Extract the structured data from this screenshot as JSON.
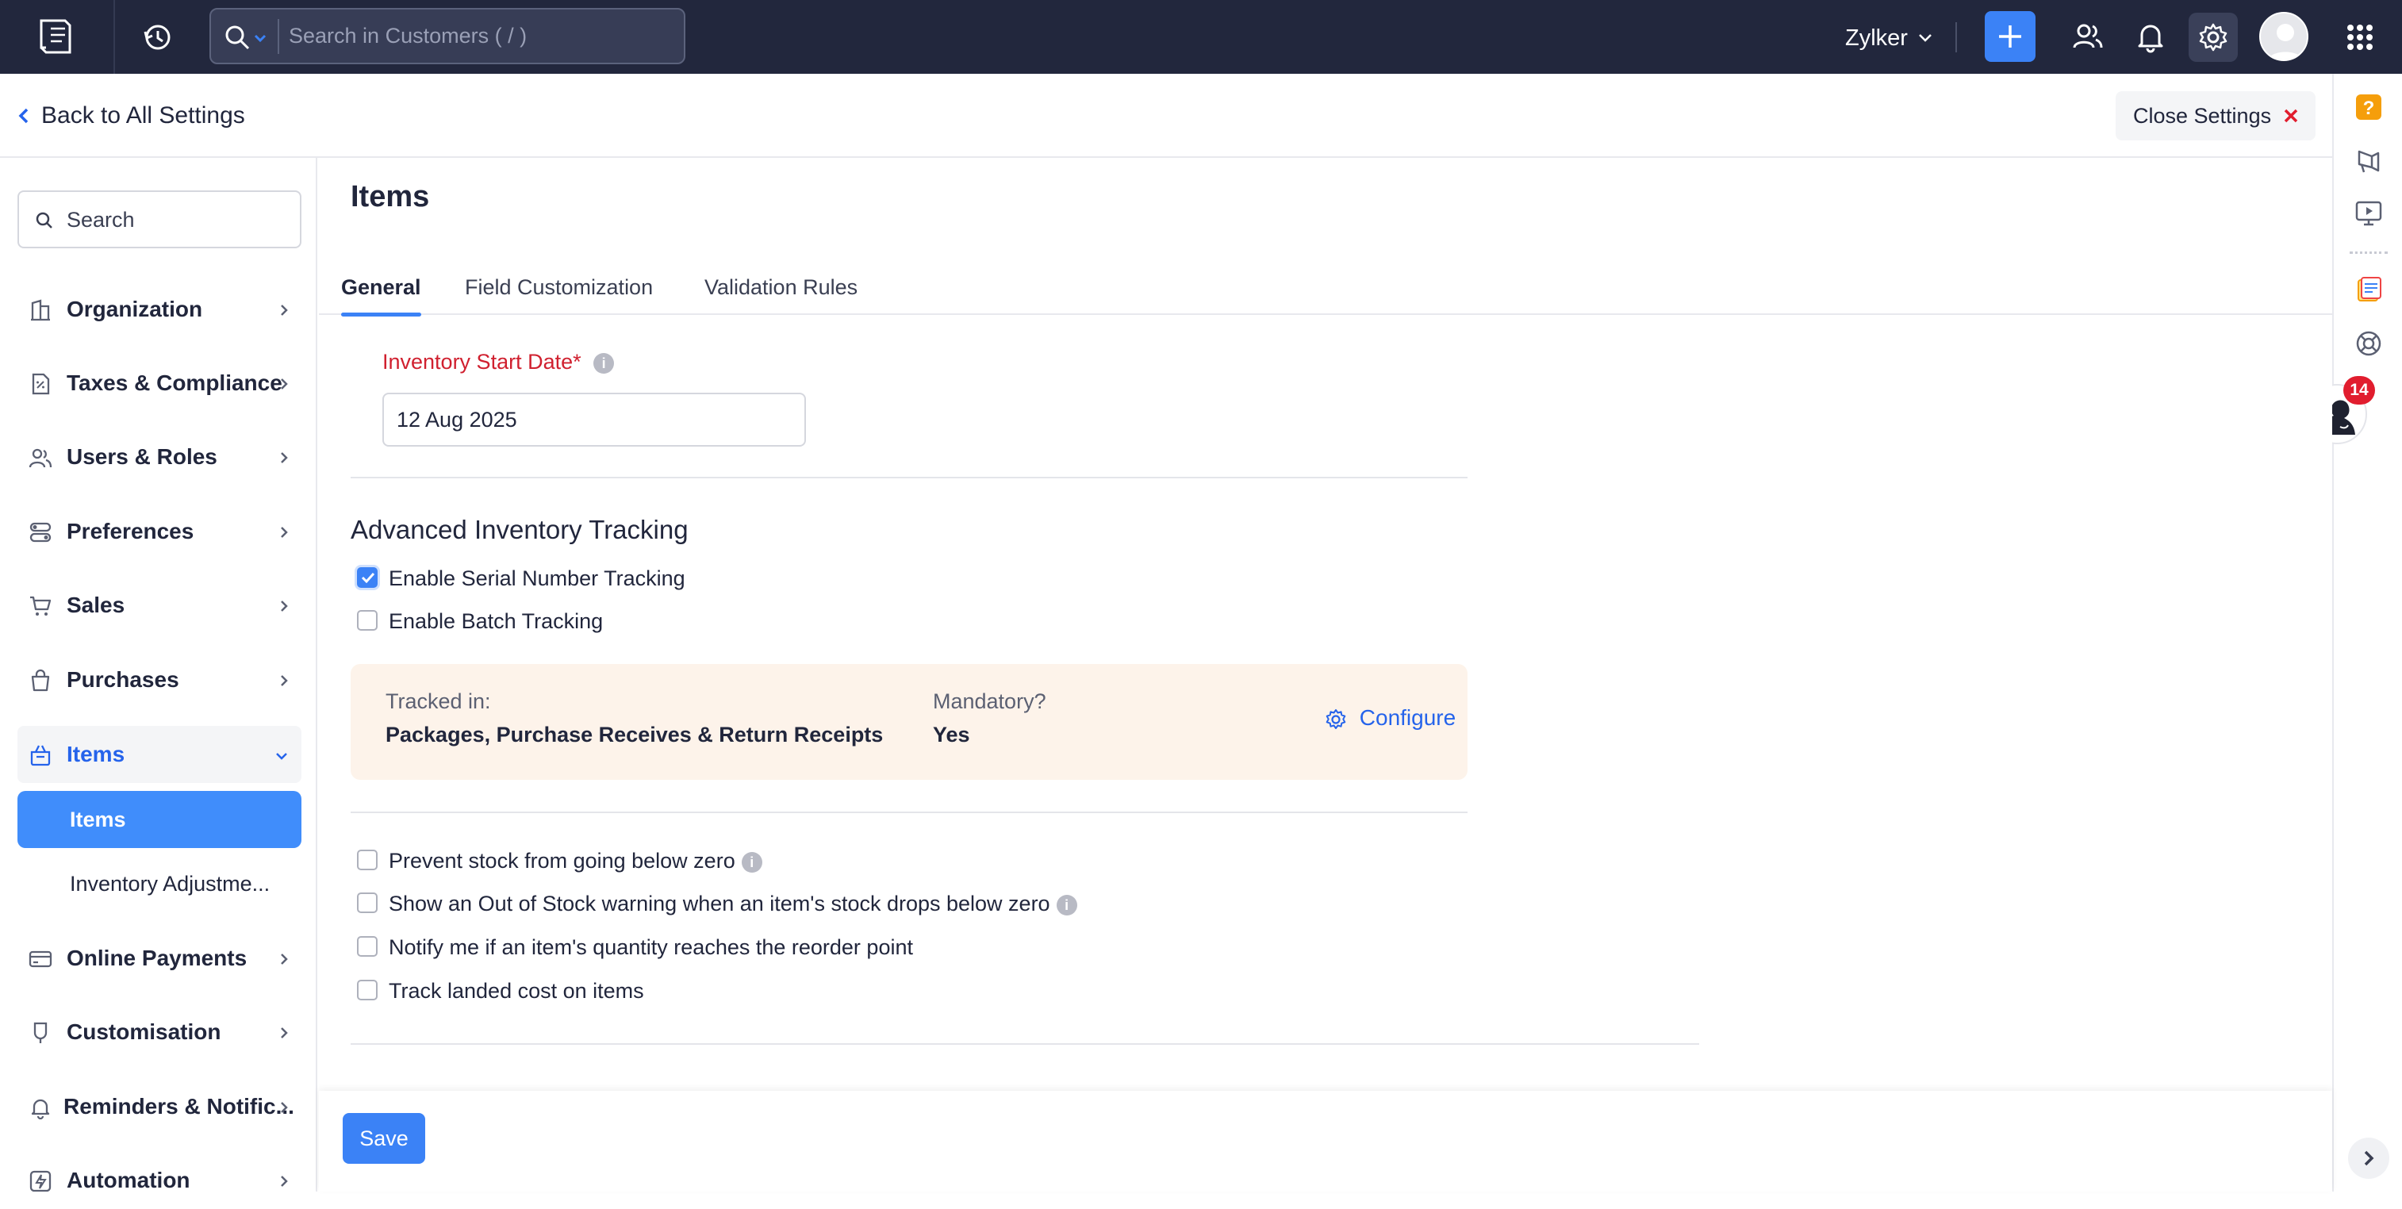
{
  "topbar": {
    "search_placeholder": "Search in Customers ( / )",
    "org_name": "Zylker"
  },
  "header": {
    "back_label": "Back to All Settings",
    "close_label": "Close Settings"
  },
  "leftnav": {
    "search_placeholder": "Search",
    "items": [
      {
        "label": "Organization",
        "icon": "building-icon"
      },
      {
        "label": "Taxes & Compliance",
        "icon": "tax-doc-icon"
      },
      {
        "label": "Users & Roles",
        "icon": "users-icon"
      },
      {
        "label": "Preferences",
        "icon": "toggles-icon"
      },
      {
        "label": "Sales",
        "icon": "cart-icon"
      },
      {
        "label": "Purchases",
        "icon": "bag-icon"
      },
      {
        "label": "Items",
        "icon": "basket-icon"
      },
      {
        "label": "Online Payments",
        "icon": "card-icon"
      },
      {
        "label": "Customisation",
        "icon": "brush-icon"
      },
      {
        "label": "Reminders & Notific...",
        "icon": "bell-icon"
      },
      {
        "label": "Automation",
        "icon": "lightning-icon"
      }
    ],
    "sub_items": [
      {
        "label": "Items",
        "active": true
      },
      {
        "label": "Inventory Adjustme...",
        "active": false
      }
    ]
  },
  "main": {
    "title": "Items",
    "tabs": [
      {
        "label": "General",
        "active": true
      },
      {
        "label": "Field Customization",
        "active": false
      },
      {
        "label": "Validation Rules",
        "active": false
      }
    ],
    "start_date_label": "Inventory Start Date*",
    "start_date_value": "12 Aug 2025",
    "advanced_heading": "Advanced Inventory Tracking",
    "serial_tracking": {
      "label": "Enable Serial Number Tracking",
      "checked": true
    },
    "batch_tracking": {
      "label": "Enable Batch Tracking",
      "checked": false
    },
    "tracking_box": {
      "tracked_in_label": "Tracked in:",
      "tracked_in_value": "Packages, Purchase Receives & Return Receipts",
      "mandatory_label": "Mandatory?",
      "mandatory_value": "Yes",
      "configure_label": "Configure"
    },
    "options": [
      {
        "label": "Prevent stock from going below zero",
        "checked": false,
        "info": true
      },
      {
        "label": "Show an Out of Stock warning when an item's stock drops below zero",
        "checked": false,
        "info": true
      },
      {
        "label": "Notify me if an item's quantity reaches the reorder point",
        "checked": false,
        "info": false
      },
      {
        "label": "Track landed cost on items",
        "checked": false,
        "info": false
      }
    ],
    "save_label": "Save"
  },
  "rail": {
    "notification_count": "14"
  },
  "colors": {
    "topbar_bg": "#22273d",
    "accent_blue": "#3b82f6",
    "required_red": "#d0202f",
    "tracking_box_bg": "#fdf3ea",
    "annotation_arrow": "#f0564a"
  }
}
